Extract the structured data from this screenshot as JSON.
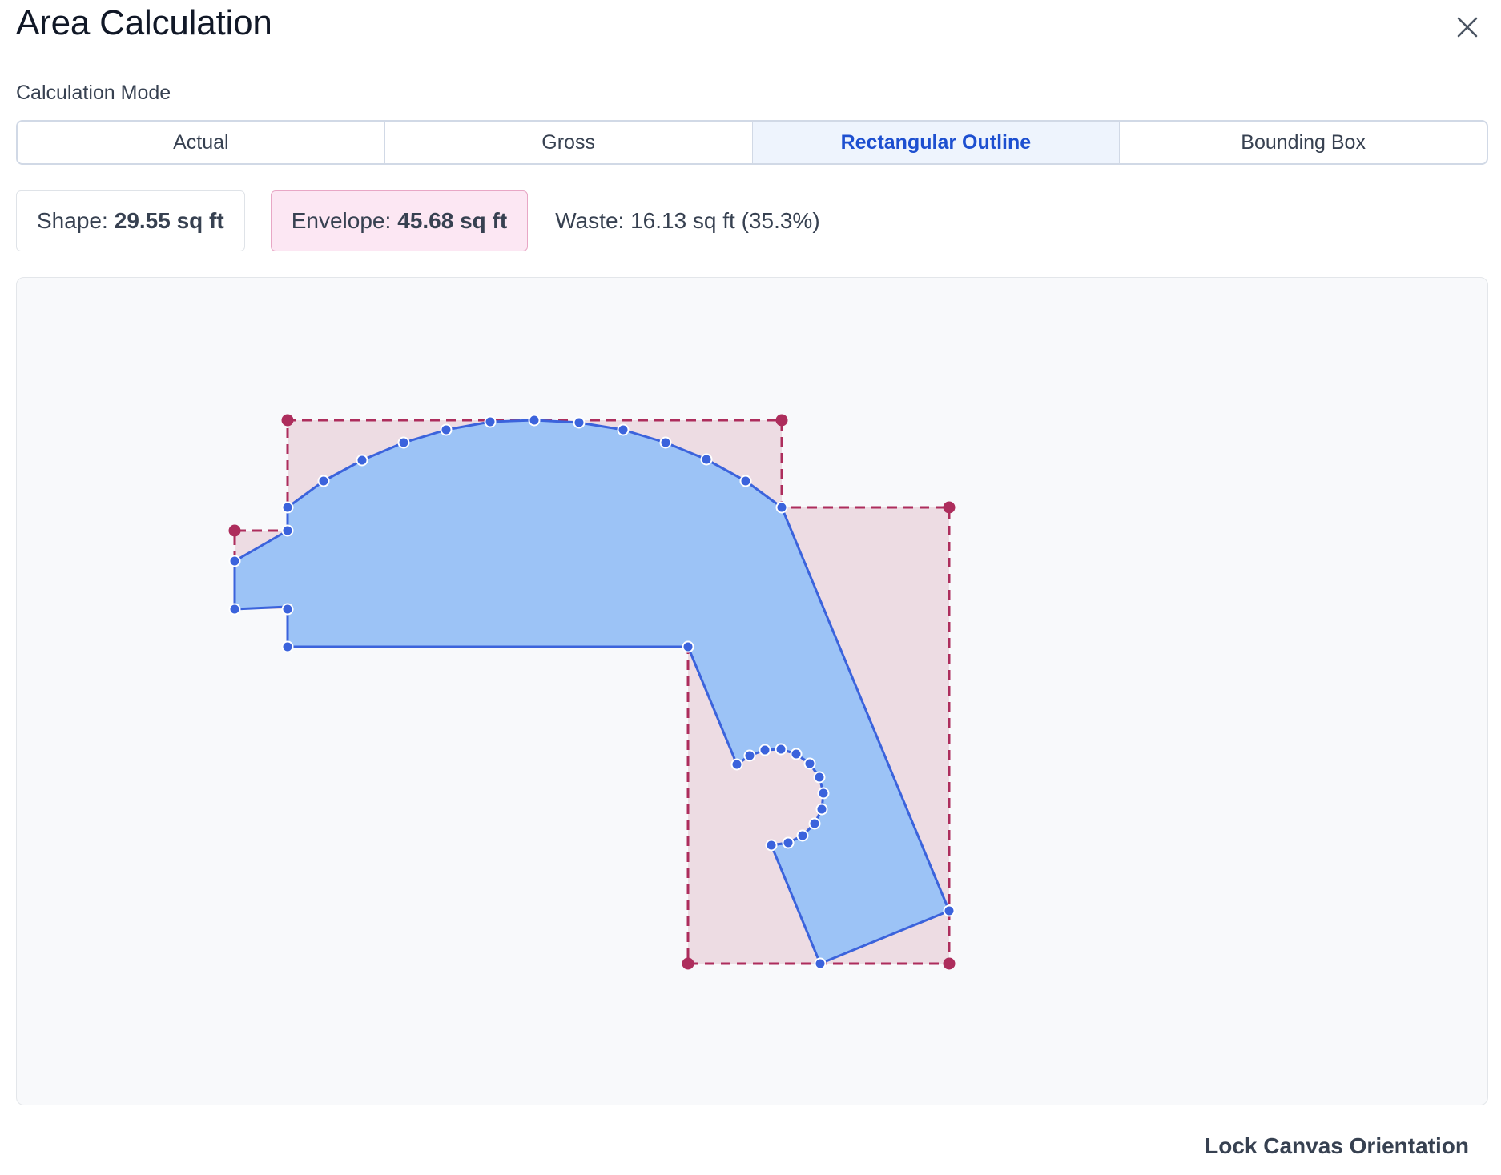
{
  "dialog": {
    "title": "Area Calculation",
    "close_icon": "close-icon"
  },
  "calculation_mode": {
    "label": "Calculation Mode",
    "options": [
      "Actual",
      "Gross",
      "Rectangular Outline",
      "Bounding Box"
    ],
    "selected": "Rectangular Outline"
  },
  "stats": {
    "shape_label": "Shape:",
    "shape_value": "29.55 sq ft",
    "envelope_label": "Envelope:",
    "envelope_value": "45.68 sq ft",
    "waste_text": "Waste: 16.13 sq ft (35.3%)"
  },
  "canvas": {
    "shape_fill": "#9cc3f6",
    "shape_stroke": "#3b63dc",
    "envelope_fill": "#eddce3",
    "envelope_stroke": "#ad2d5c"
  },
  "footer": {
    "lock_label": "Lock Canvas Orientation"
  }
}
